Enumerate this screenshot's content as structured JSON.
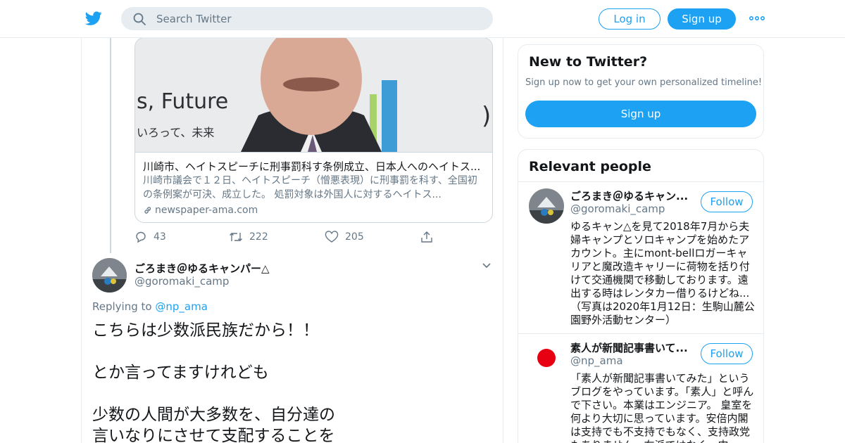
{
  "header": {
    "search_placeholder": "Search Twitter",
    "login_label": "Log in",
    "signup_label": "Sign up",
    "icons": [
      "twitter-bird-icon",
      "search-icon",
      "more-dots-icon"
    ],
    "brand_color": "#1da1f2"
  },
  "link_card": {
    "image_text": "s, Future  いろって、未来",
    "title": "川崎市、ヘイトスピーチに刑事罰科す条例成立、日本人へのヘイトス...",
    "description": "川崎市議会で１２日、ヘイトスピーチ（憎悪表現）に刑事罰を科す、全国初の条例案が可決、成立した。 処罰対象は外国人に対するヘイトス...",
    "domain": "newspaper-ama.com"
  },
  "tweet_actions": {
    "replies": "43",
    "retweets": "222",
    "likes": "205"
  },
  "tweet": {
    "name": "ごろまき＠ゆるキャンパー△",
    "handle": "@goromaki_camp",
    "replying_prefix": "Replying to",
    "replying_to": "@np_ama",
    "body": "こちらは少数派民族だから！！\n\nとか言ってますけれども\n\n少数の人間が大多数を、自分達の\n言いなりにさせて支配することを"
  },
  "sidebar": {
    "new_to_twitter": {
      "title": "New to Twitter?",
      "subtitle": "Sign up now to get your own personalized timeline!",
      "signup_label": "Sign up"
    },
    "relevant_people": {
      "title": "Relevant people",
      "people": [
        {
          "name": "ごろまき＠ゆるキャン...",
          "handle": "@goromaki_camp",
          "follow_label": "Follow",
          "bio": "ゆるキャン△を見て2018年7月から夫婦キャンプとソロキャンプを始めたアカウント。主にmont-bellロガーキャリアと魔改造キャリーに荷物を括り付けて交通機関で移動しております。遠出する時はレンタカー借りるけどね...　（写真は2020年1月12日：生駒山麓公園野外活動センター）"
        },
        {
          "name": "素人が新聞記事書いて...",
          "handle": "@np_ama",
          "follow_label": "Follow",
          "bio": "「素人が新聞記事書いてみた」というブログをやっています。「素人」と呼んで下さい。本業はエンジニア。 皇室を何より大切に思っています。安倍内閣は支持でも不支持でもなく、支持政党もありません。右派ではなく、中"
        }
      ]
    }
  }
}
